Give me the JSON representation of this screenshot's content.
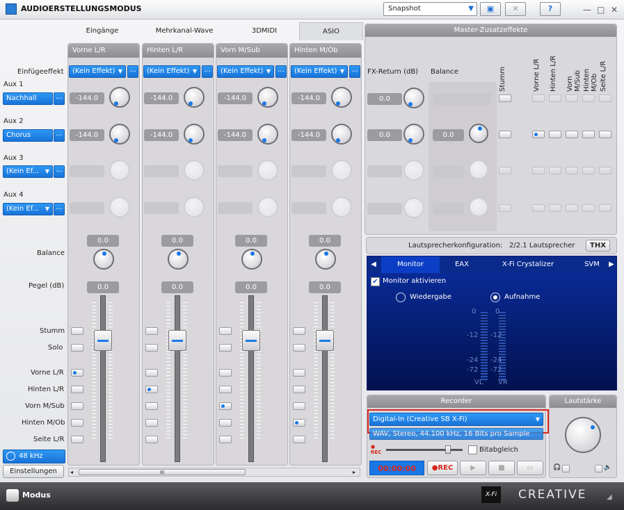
{
  "window": {
    "title": "AUDIOERSTELLUNGSMODUS",
    "snapshot_value": "Snapshot",
    "help_label": "?",
    "close_x": "✕",
    "minimize": "—",
    "maximize": "□",
    "close": "✕"
  },
  "tabs": [
    "Eingänge",
    "Mehrkanal-Wave",
    "3DMIDI",
    "ASIO"
  ],
  "left": {
    "insert_effect_label": "Einfügeeffekt",
    "aux1_label": "Aux 1",
    "aux1_value": "Nachhall",
    "aux2_label": "Aux 2",
    "aux2_value": "Chorus",
    "aux3_label": "Aux 3",
    "aux3_value": "(Kein Ef...",
    "aux4_label": "Aux 4",
    "aux4_value": "(Kein Ef...",
    "more": "...",
    "balance_label": "Balance",
    "level_label": "Pegel (dB)",
    "mute_label": "Stumm",
    "solo_label": "Solo",
    "route_labels": [
      "Vorne L/R",
      "Hinten L/R",
      "Vorn M/Sub",
      "Hinten M/Ob",
      "Seite L/R"
    ],
    "sample_rate": "48 kHz",
    "settings_button": "Einstellungen"
  },
  "strips": [
    {
      "name": "Vorne L/R",
      "effect": "(Kein Effekt)",
      "aux1": "-144.0",
      "aux2": "-144.0",
      "balance": "0.0",
      "level": "0.0",
      "route_active": 0
    },
    {
      "name": "Hinten L/R",
      "effect": "(Kein Effekt)",
      "aux1": "-144.0",
      "aux2": "-144.0",
      "balance": "0.0",
      "level": "0.0",
      "route_active": 1
    },
    {
      "name": "Vorn M/Sub",
      "effect": "(Kein Effekt)",
      "aux1": "-144.0",
      "aux2": "-144.0",
      "balance": "0.0",
      "level": "0.0",
      "route_active": 2
    },
    {
      "name": "Hinten M/Ob",
      "effect": "(Kein Effekt)",
      "aux1": "-144.0",
      "aux2": "-144.0",
      "balance": "0.0",
      "level": "0.0",
      "route_active": 3
    }
  ],
  "master": {
    "title": "Master-Zusatzeffekte",
    "fx_return_label": "FX-Return (dB)",
    "balance_label": "Balance",
    "mute_label": "Stumm",
    "columns": [
      "Vorne L/R",
      "Hinten L/R",
      "Vorn M/Sub",
      "Hinten M/Ob",
      "Seite L/R"
    ],
    "fx1": "0.0",
    "fx2": "0.0",
    "bal2": "0.0"
  },
  "speaker": {
    "label": "Lautsprecherkonfiguration:",
    "value": "2/2.1 Lautsprecher",
    "thx": "THX"
  },
  "monitor": {
    "tabs": [
      "Monitor",
      "EAX",
      "X-Fi Crystalizer",
      "SVM"
    ],
    "enable_label": "Monitor aktivieren",
    "playback_label": "Wiedergabe",
    "record_label": "Aufnahme",
    "scale": [
      "0",
      "-12",
      "-24",
      "-72"
    ],
    "meter_labels": [
      "VL",
      "VR"
    ]
  },
  "recorder": {
    "title": "Recorder",
    "source": "Digital-In (Creative SB X-Fi)",
    "format": "WAV, Stereo, 44.100 kHz, 16 Bits pro Sample",
    "rec_small": "REC",
    "bitmatch": "Bitabgleich",
    "time": "00:00:00",
    "rec_button": "REC"
  },
  "volume": {
    "title": "Lautstärke"
  },
  "status": {
    "mode": "Modus",
    "brand": "CREATIVE",
    "xfi": "X-Fi"
  },
  "scrollbar": {
    "grip": "III"
  },
  "colors": {
    "accent": "#1a78e6",
    "highlight_box": "#d9261c",
    "monitor_bg": "#0a2ea0"
  }
}
